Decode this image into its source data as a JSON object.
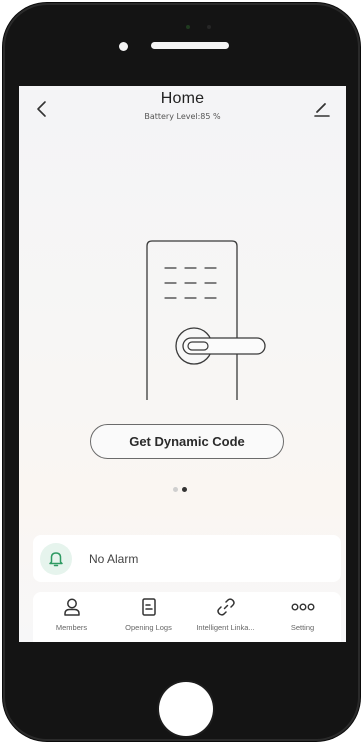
{
  "header": {
    "title": "Home",
    "battery_label": "Battery Level:85 %"
  },
  "main": {
    "illustration_icon": "door-lock-icon",
    "dynamic_code_button": "Get Dynamic Code",
    "pager": {
      "total": 2,
      "active": 2
    }
  },
  "alarm": {
    "icon": "bell-icon",
    "text": "No Alarm"
  },
  "nav": {
    "items": [
      {
        "label": "Members",
        "icon": "person-icon"
      },
      {
        "label": "Opening Logs",
        "icon": "log-document-icon"
      },
      {
        "label": "Intelligent Linka...",
        "icon": "link-icon"
      },
      {
        "label": "Setting",
        "icon": "more-dots-icon"
      }
    ]
  },
  "colors": {
    "accent": "#2e9a62",
    "accent_bg": "#e6f4ed",
    "text": "#222222",
    "frame": "#141414"
  }
}
